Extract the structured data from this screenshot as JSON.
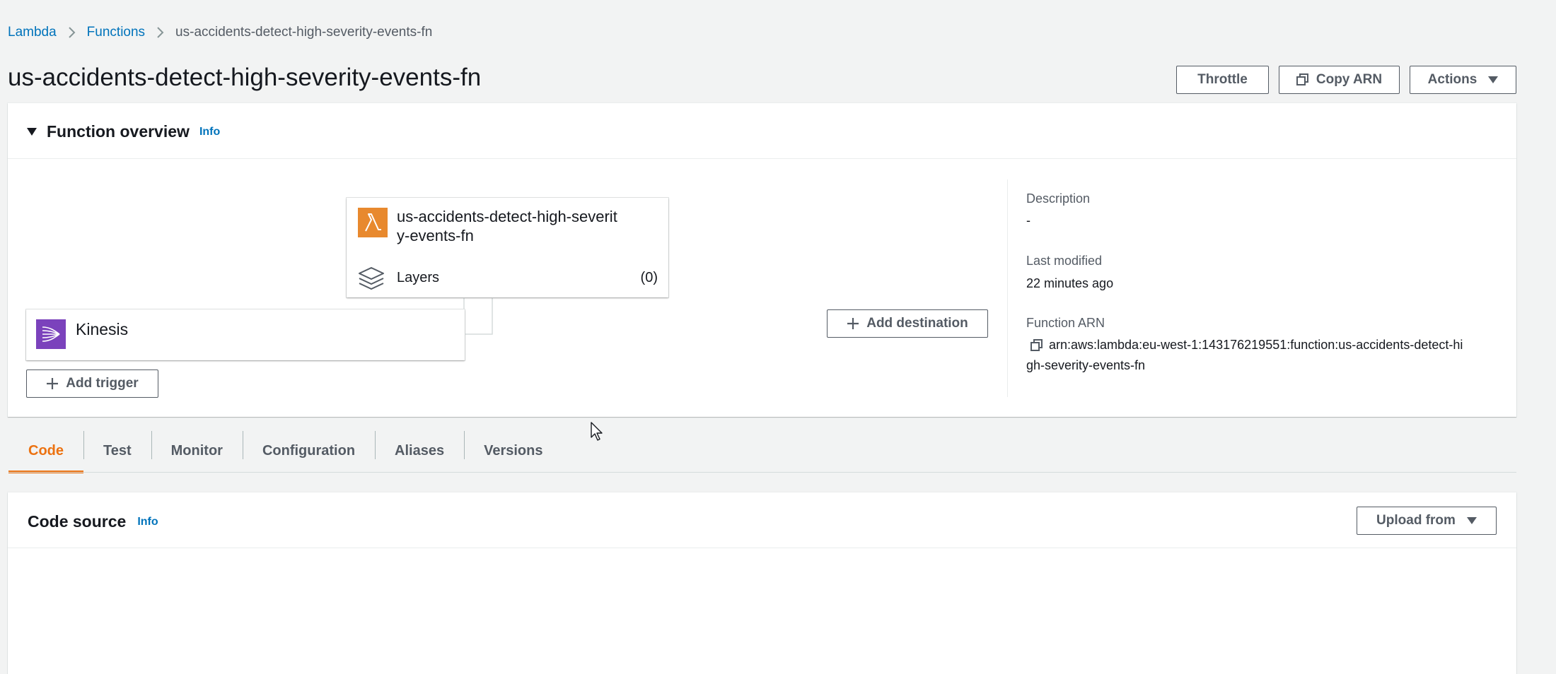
{
  "breadcrumb": {
    "root": "Lambda",
    "functions": "Functions",
    "current": "us-accidents-detect-high-severity-events-fn"
  },
  "page_title": "us-accidents-detect-high-severity-events-fn",
  "header_buttons": {
    "throttle": "Throttle",
    "copy_arn": "Copy ARN",
    "actions": "Actions"
  },
  "overview": {
    "title": "Function overview",
    "info": "Info",
    "function_card": {
      "name_line1": "us-accidents-detect-high-severit",
      "name_line2": "y-events-fn",
      "layers_label": "Layers",
      "layers_count": "(0)"
    },
    "trigger": {
      "name": "Kinesis"
    },
    "add_trigger": "Add trigger",
    "add_destination": "Add destination",
    "details": {
      "description_label": "Description",
      "description_value": "-",
      "last_modified_label": "Last modified",
      "last_modified_value": "22 minutes ago",
      "arn_label": "Function ARN",
      "arn_line1": "arn:aws:lambda:eu-west-1:143176219551:function:us-accidents-detect-hi",
      "arn_line2": "gh-severity-events-fn"
    }
  },
  "tabs": [
    {
      "label": "Code",
      "active": true
    },
    {
      "label": "Test",
      "active": false
    },
    {
      "label": "Monitor",
      "active": false
    },
    {
      "label": "Configuration",
      "active": false
    },
    {
      "label": "Aliases",
      "active": false
    },
    {
      "label": "Versions",
      "active": false
    }
  ],
  "code_source": {
    "title": "Code source",
    "info": "Info",
    "upload_from": "Upload from"
  },
  "colors": {
    "accent": "#ec7211",
    "link": "#0073bb",
    "lambda_icon": "#e8892e",
    "kinesis_icon": "#7b42bc"
  },
  "icons": {
    "breadcrumb_separator": "chevron-right-icon",
    "copy": "copy-icon",
    "dropdown": "caret-down-icon",
    "lambda": "lambda-icon",
    "layers": "layers-icon",
    "kinesis": "kinesis-icon",
    "add": "plus-icon",
    "collapse": "triangle-down-icon",
    "cursor": "mouse-pointer-icon"
  }
}
